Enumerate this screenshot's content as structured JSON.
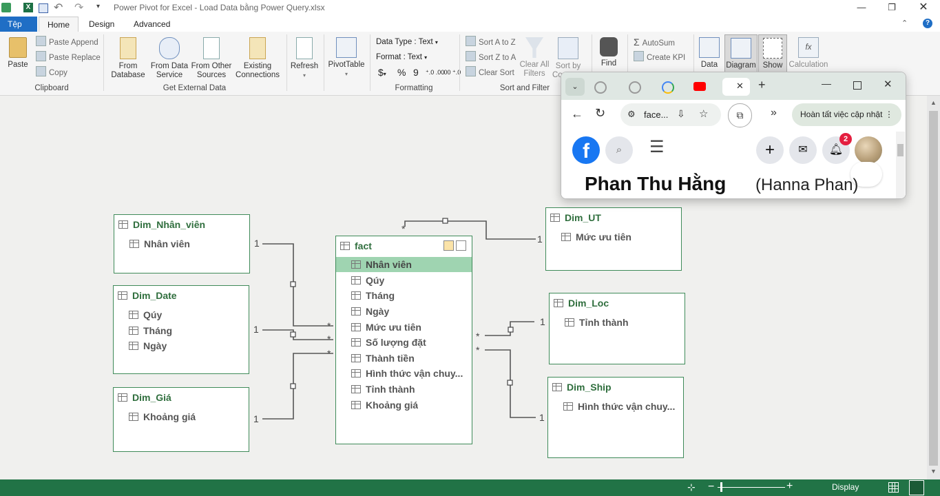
{
  "window": {
    "title": "Power Pivot for Excel - Load Data bằng Power Query.xlsx"
  },
  "tabs": [
    {
      "label": "Tệp"
    },
    {
      "label": "Home"
    },
    {
      "label": "Design"
    },
    {
      "label": "Advanced"
    }
  ],
  "ribbon": {
    "clipboard": {
      "paste": "Paste",
      "paste_append": "Paste Append",
      "paste_replace": "Paste Replace",
      "copy": "Copy",
      "group": "Clipboard"
    },
    "external": {
      "from_database_1": "From",
      "from_database_2": "Database",
      "from_data_service_1": "From Data",
      "from_data_service_2": "Service",
      "from_other_1": "From Other",
      "from_other_2": "Sources",
      "existing_1": "Existing",
      "existing_2": "Connections",
      "group": "Get External Data"
    },
    "refresh": "Refresh",
    "pivottable": "PivotTable",
    "formatting": {
      "data_type": "Data Type : Text",
      "format": "Format : Text",
      "currency": "$",
      "percent": "%",
      "comma": "9",
      "inc_dec": "⁺.0 .00",
      "dec_dec": ".00 ⁺.0",
      "group": "Formatting"
    },
    "sort": {
      "sort_az": "Sort A to Z",
      "sort_za": "Sort Z to A",
      "clear_sort": "Clear Sort",
      "clear_all_1": "Clear All",
      "clear_all_2": "Filters",
      "sort_by_1": "Sort by",
      "sort_by_2": "Co",
      "group": "Sort and Filter"
    },
    "find": "Find",
    "autosum": "AutoSum",
    "create_kpi": "Create KPI",
    "view": {
      "data": "Data",
      "diagram": "Diagram",
      "show": "Show",
      "calculation": "Calculation"
    }
  },
  "diagram": {
    "tables": [
      {
        "name": "Dim_Nhân_viên",
        "columns": [
          "Nhân viên"
        ]
      },
      {
        "name": "Dim_Date",
        "columns": [
          "Qúy",
          "Tháng",
          "Ngày"
        ]
      },
      {
        "name": "Dim_Giá",
        "columns": [
          "Khoảng giá"
        ]
      },
      {
        "name": "fact",
        "columns": [
          "Nhân viên",
          "Qúy",
          "Tháng",
          "Ngày",
          "Mức ưu tiên",
          "Số lượng đặt",
          "Thành tiền",
          "Hình thức vận chuy...",
          "Tỉnh thành",
          "Khoảng giá"
        ]
      },
      {
        "name": "Dim_UT",
        "columns": [
          "Mức ưu tiên"
        ]
      },
      {
        "name": "Dim_Loc",
        "columns": [
          "Tỉnh thành"
        ]
      },
      {
        "name": "Dim_Ship",
        "columns": [
          "Hình thức vận chuy..."
        ]
      }
    ],
    "one": "1",
    "many": "*"
  },
  "statusbar": {
    "display": "Display"
  },
  "chrome": {
    "url": "face...",
    "update": "Hoàn tất việc cập nhật",
    "notif_count": "2",
    "profile_name": "Phan Thu Hằng",
    "profile_alt": "(Hanna Phan)"
  },
  "colors": {
    "excel_green": "#217346",
    "table_border": "#3e8a58",
    "selected_row": "#9fd4b1",
    "file_tab": "#1f6ec5",
    "facebook_blue": "#1877f2"
  }
}
